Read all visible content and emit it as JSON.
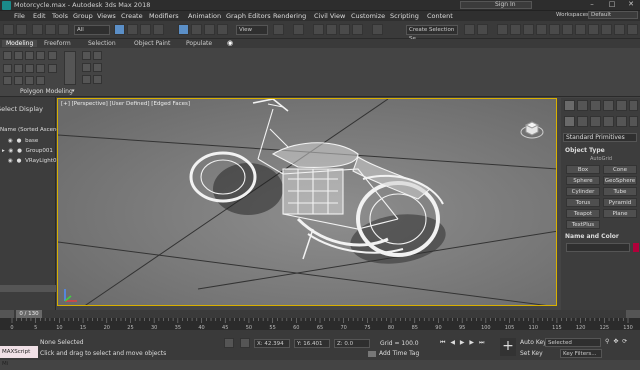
{
  "window": {
    "title": "Motorcycle.max - Autodesk 3ds Max 2018"
  },
  "signin": {
    "label": "Sign In"
  },
  "menu": [
    "File",
    "Edit",
    "Tools",
    "Group",
    "Views",
    "Create",
    "Modifiers",
    "Animation",
    "Graph Editors",
    "Rendering",
    "Civil View",
    "Customize",
    "Scripting",
    "Content"
  ],
  "workspaces": {
    "label": "Workspaces:",
    "value": "Default"
  },
  "toolbar": {
    "filter": "All",
    "view": "View",
    "selection_set": "Create Selection Se"
  },
  "ribbon_tabs": [
    "Modeling",
    "Freeform",
    "Selection",
    "Object Paint",
    "Populate"
  ],
  "ribbon": {
    "label": "Polygon Modeling"
  },
  "scene_explorer": {
    "tabs": [
      "Select",
      "Display"
    ],
    "header": "Name (Sorted Ascendin",
    "items": [
      "base",
      "Group001",
      "VRayLight01"
    ]
  },
  "viewport": {
    "label": "[+] [Perspective] [User Defined] [Edged Faces]"
  },
  "command_panel": {
    "dropdown": "Standard Primitives",
    "object_type_title": "Object Type",
    "autogrid": "AutoGrid",
    "buttons": [
      "Box",
      "Cone",
      "Sphere",
      "GeoSphere",
      "Cylinder",
      "Tube",
      "Torus",
      "Pyramid",
      "Teapot",
      "Plane",
      "TextPlus"
    ],
    "name_color_title": "Name and Color"
  },
  "timeline": {
    "frame": "0 / 130",
    "ticks": [
      "0",
      "5",
      "10",
      "15",
      "20",
      "25",
      "30",
      "35",
      "40",
      "45",
      "50",
      "55",
      "60",
      "65",
      "70",
      "75",
      "80",
      "85",
      "90",
      "95",
      "100",
      "105",
      "110",
      "115",
      "120",
      "125",
      "130"
    ]
  },
  "status": {
    "script": "MAXScript Mi",
    "selected": "None Selected",
    "prompt": "Click and drag to select and move objects",
    "x": "X: 42.394",
    "y": "Y: 16.401",
    "z": "Z: 0.0",
    "grid": "Grid = 100.0",
    "add_time_tag": "Add Time Tag",
    "autokey": "Auto Key",
    "setkey": "Set Key",
    "selected_dd": "Selected",
    "key_filters": "Key Filters..."
  }
}
